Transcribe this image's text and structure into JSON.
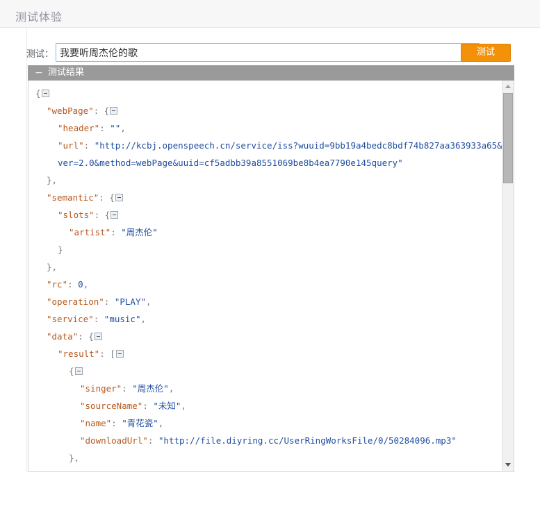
{
  "page": {
    "title": "测试体验"
  },
  "form": {
    "label": "测试：",
    "input_value": "我要听周杰伦的歌",
    "input_placeholder": "",
    "submit_label": "测试"
  },
  "result_panel": {
    "header_label": "测试结果",
    "collapse_toggle": "−"
  },
  "scrollbar": {
    "up_arrow": "scroll-up-arrow",
    "down_arrow": "scroll-down-arrow"
  },
  "json_lines": [
    {
      "indent": 0,
      "parts": [
        {
          "t": "punct",
          "s": "{"
        },
        {
          "t": "toggle"
        }
      ]
    },
    {
      "indent": 1,
      "parts": [
        {
          "t": "key",
          "s": "\"webPage\""
        },
        {
          "t": "punct",
          "s": ": {"
        },
        {
          "t": "toggle"
        }
      ]
    },
    {
      "indent": 2,
      "parts": [
        {
          "t": "key",
          "s": "\"header\""
        },
        {
          "t": "punct",
          "s": ": "
        },
        {
          "t": "val",
          "s": "\"\""
        },
        {
          "t": "punct",
          "s": ","
        }
      ]
    },
    {
      "indent": 2,
      "parts": [
        {
          "t": "key",
          "s": "\"url\""
        },
        {
          "t": "punct",
          "s": ": "
        },
        {
          "t": "val",
          "s": "\"http://kcbj.openspeech.cn/service/iss?wuuid=9bb19a4bedc8bdf74b827aa363933a65&ver=2.0&method=webPage&uuid=cf5adbb39a8551069be8b4ea7790e145query\""
        }
      ]
    },
    {
      "indent": 1,
      "parts": [
        {
          "t": "punct",
          "s": "},"
        }
      ]
    },
    {
      "indent": 1,
      "parts": [
        {
          "t": "key",
          "s": "\"semantic\""
        },
        {
          "t": "punct",
          "s": ": {"
        },
        {
          "t": "toggle"
        }
      ]
    },
    {
      "indent": 2,
      "parts": [
        {
          "t": "key",
          "s": "\"slots\""
        },
        {
          "t": "punct",
          "s": ": {"
        },
        {
          "t": "toggle"
        }
      ]
    },
    {
      "indent": 3,
      "parts": [
        {
          "t": "key",
          "s": "\"artist\""
        },
        {
          "t": "punct",
          "s": ": "
        },
        {
          "t": "val",
          "s": "\"周杰伦\""
        }
      ]
    },
    {
      "indent": 2,
      "parts": [
        {
          "t": "punct",
          "s": "}"
        }
      ]
    },
    {
      "indent": 1,
      "parts": [
        {
          "t": "punct",
          "s": "},"
        }
      ]
    },
    {
      "indent": 1,
      "parts": [
        {
          "t": "key",
          "s": "\"rc\""
        },
        {
          "t": "punct",
          "s": ": "
        },
        {
          "t": "val",
          "s": "0"
        },
        {
          "t": "punct",
          "s": ","
        }
      ]
    },
    {
      "indent": 1,
      "parts": [
        {
          "t": "key",
          "s": "\"operation\""
        },
        {
          "t": "punct",
          "s": ": "
        },
        {
          "t": "val",
          "s": "\"PLAY\""
        },
        {
          "t": "punct",
          "s": ","
        }
      ]
    },
    {
      "indent": 1,
      "parts": [
        {
          "t": "key",
          "s": "\"service\""
        },
        {
          "t": "punct",
          "s": ": "
        },
        {
          "t": "val",
          "s": "\"music\""
        },
        {
          "t": "punct",
          "s": ","
        }
      ]
    },
    {
      "indent": 1,
      "parts": [
        {
          "t": "key",
          "s": "\"data\""
        },
        {
          "t": "punct",
          "s": ": {"
        },
        {
          "t": "toggle"
        }
      ]
    },
    {
      "indent": 2,
      "parts": [
        {
          "t": "key",
          "s": "\"result\""
        },
        {
          "t": "punct",
          "s": ": ["
        },
        {
          "t": "toggle"
        }
      ]
    },
    {
      "indent": 3,
      "parts": [
        {
          "t": "punct",
          "s": "{"
        },
        {
          "t": "toggle"
        }
      ]
    },
    {
      "indent": 4,
      "parts": [
        {
          "t": "key",
          "s": "\"singer\""
        },
        {
          "t": "punct",
          "s": ": "
        },
        {
          "t": "val",
          "s": "\"周杰伦\""
        },
        {
          "t": "punct",
          "s": ","
        }
      ]
    },
    {
      "indent": 4,
      "parts": [
        {
          "t": "key",
          "s": "\"sourceName\""
        },
        {
          "t": "punct",
          "s": ": "
        },
        {
          "t": "val",
          "s": "\"未知\""
        },
        {
          "t": "punct",
          "s": ","
        }
      ]
    },
    {
      "indent": 4,
      "parts": [
        {
          "t": "key",
          "s": "\"name\""
        },
        {
          "t": "punct",
          "s": ": "
        },
        {
          "t": "val",
          "s": "\"青花瓷\""
        },
        {
          "t": "punct",
          "s": ","
        }
      ]
    },
    {
      "indent": 4,
      "parts": [
        {
          "t": "key",
          "s": "\"downloadUrl\""
        },
        {
          "t": "punct",
          "s": ": "
        },
        {
          "t": "val",
          "s": "\"http://file.diyring.cc/UserRingWorksFile/0/50284096.mp3\""
        }
      ]
    },
    {
      "indent": 3,
      "parts": [
        {
          "t": "punct",
          "s": "},"
        }
      ]
    }
  ]
}
